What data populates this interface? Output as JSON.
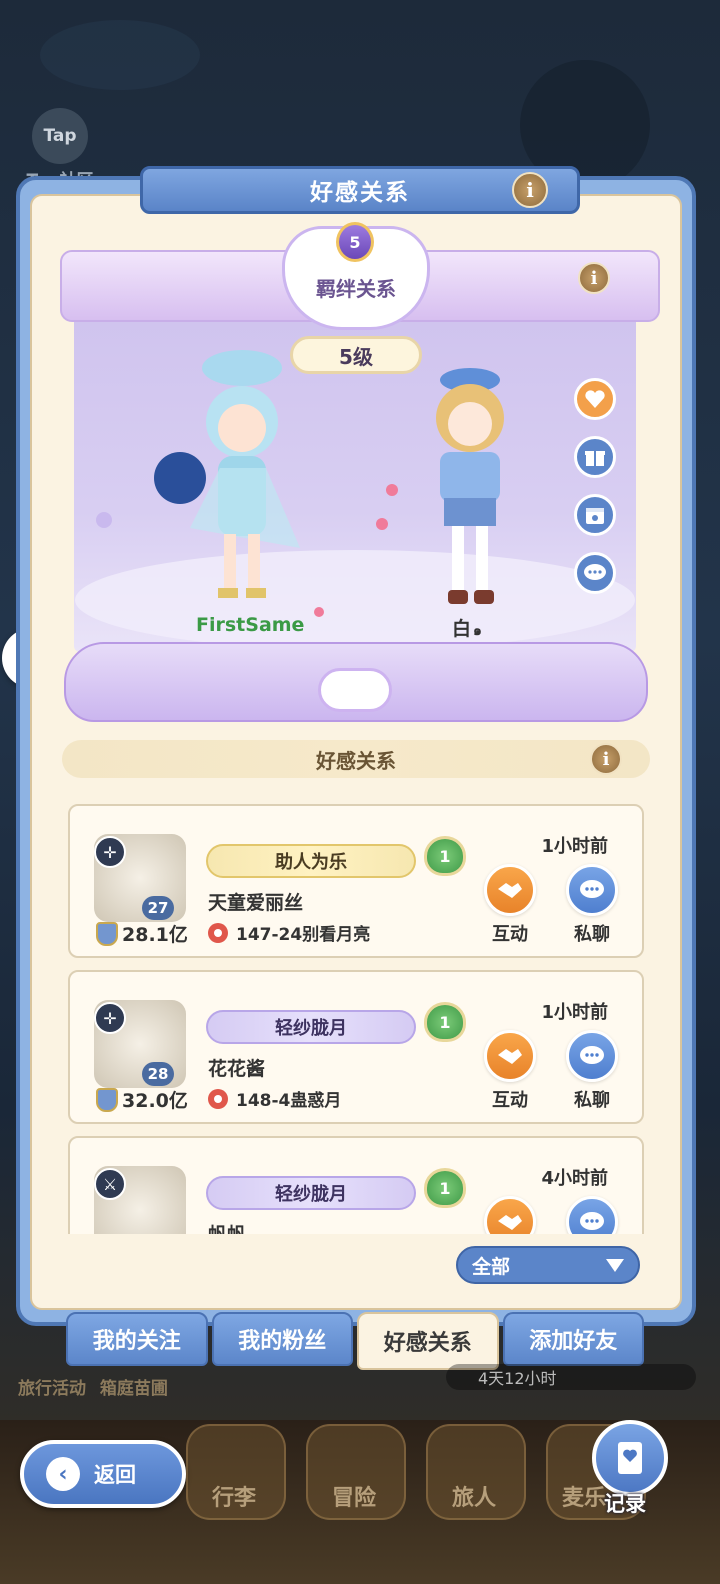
{
  "community": {
    "label": "Tap社区"
  },
  "panel": {
    "title": "好感关系"
  },
  "bond": {
    "title": "羁绊关系",
    "level_badge": "5",
    "level_text": "5级",
    "left_player": "FirstSame",
    "right_player": "白",
    "right_player_suffix": "๑"
  },
  "section": {
    "title": "好感关系"
  },
  "list": [
    {
      "tag": "助人为乐",
      "tag_style": "gold",
      "affinity": "1",
      "name": "天童爱丽丝",
      "server": "147-24别看月亮",
      "level": "27",
      "power": "28.1亿",
      "time": "1小时前",
      "interact": "互动",
      "chat": "私聊"
    },
    {
      "tag": "轻纱胧月",
      "tag_style": "purple",
      "affinity": "1",
      "name": "花花酱",
      "server": "148-4蛊惑月",
      "level": "28",
      "power": "32.0亿",
      "time": "1小时前",
      "interact": "互动",
      "chat": "私聊"
    },
    {
      "tag": "轻纱胧月",
      "tag_style": "purple",
      "affinity": "1",
      "name": "帆帆",
      "server": "",
      "level": "",
      "power": "",
      "time": "4小时前",
      "interact": "",
      "chat": ""
    }
  ],
  "filter": {
    "value": "全部"
  },
  "tabs": [
    "我的关注",
    "我的粉丝",
    "好感关系",
    "添加好友"
  ],
  "under": {
    "left1": "旅行活动",
    "left2": "箱庭苗圃",
    "timer": "4天12小时"
  },
  "nav": [
    "行李",
    "冒险",
    "旅人",
    "麦乐"
  ],
  "back": {
    "label": "返回"
  },
  "record": {
    "label": "记录"
  },
  "colors": {
    "panel_blue": "#5a84c8",
    "orange": "#e8832a",
    "green_heart": "#3f9a48",
    "cream": "#fbf3e2"
  }
}
